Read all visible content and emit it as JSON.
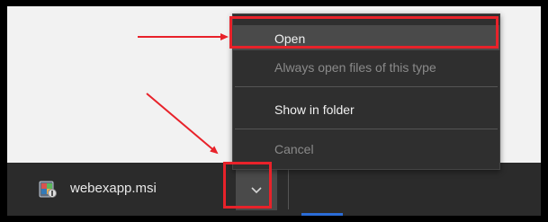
{
  "menu": {
    "items": [
      {
        "label": "Open",
        "state": "highlighted"
      },
      {
        "label": "Always open files of this type",
        "state": "disabled"
      },
      {
        "label": "Show in folder",
        "state": "enabled"
      },
      {
        "label": "Cancel",
        "state": "disabled"
      }
    ]
  },
  "download": {
    "file_name": "webexapp.msi",
    "icon": "installer-package-icon",
    "menu_button_icon": "chevron-down-icon"
  },
  "annotations": {
    "color": "#e8222a"
  }
}
